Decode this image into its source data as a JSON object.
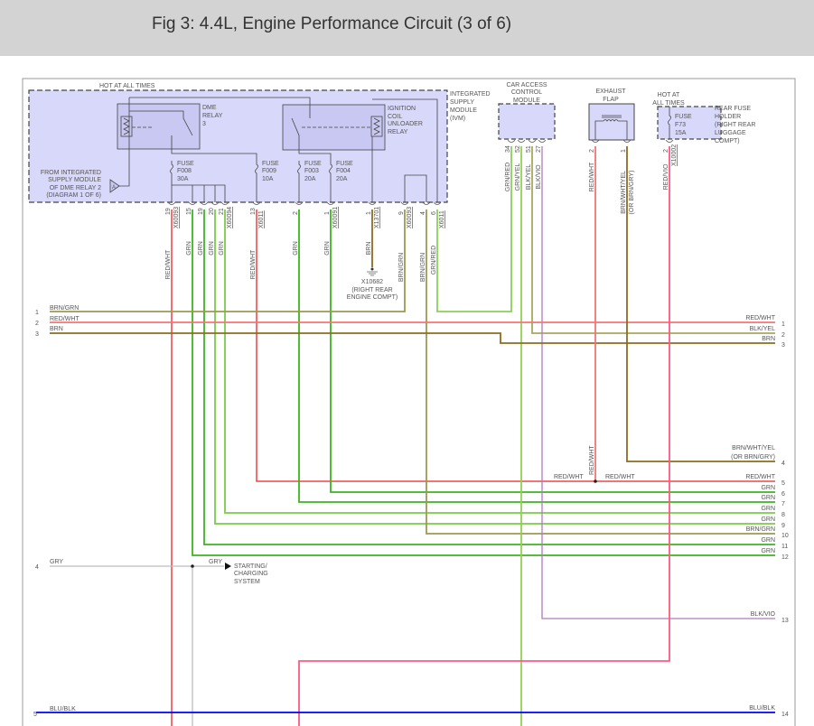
{
  "header": {
    "title": "Fig 3: 4.4L, Engine Performance Circuit (3 of 6)"
  },
  "colors": {
    "red": "#ee2222",
    "redwht": "#f47474",
    "grn": "#3cb521",
    "grnlt": "#7acb4a",
    "brn": "#8c6d1f",
    "brngrn": "#9c9a52",
    "grnred": "#8ccf5a",
    "grnyel": "#8fd14f",
    "blkyel": "#a8a860",
    "vio": "#b07ac0",
    "gry": "#bdbdbd",
    "blu": "#0000ff",
    "redvio": "#ff5a80",
    "ivm_fill": "#d8d8fa",
    "box_fill": "#ccccf5"
  },
  "ivm": {
    "hot_label": "HOT AT ALL TIMES",
    "name_lines": [
      "INTEGRATED",
      "SUPPLY",
      "MODULE",
      "(IVM)"
    ],
    "dme_relay": [
      "DME",
      "RELAY",
      "3"
    ],
    "ign_relay": [
      "IGNITION",
      "COIL",
      "UNLOADER",
      "RELAY"
    ],
    "from_label": [
      "FROM INTEGRATED",
      "SUPPLY MODULE",
      "OF DME RELAY 2",
      "(DIAGRAM 1 OF 6)"
    ],
    "ref_symbol": "A",
    "fuses": [
      {
        "lines": [
          "FUSE",
          "F008",
          "30A"
        ]
      },
      {
        "lines": [
          "FUSE",
          "F009",
          "10A"
        ]
      },
      {
        "lines": [
          "FUSE",
          "F003",
          "20A"
        ]
      },
      {
        "lines": [
          "FUSE",
          "F004",
          "20A"
        ]
      }
    ],
    "pins": [
      {
        "pin": "19",
        "conn": "X60093",
        "wire": "RED/WHT"
      },
      {
        "pin": "15",
        "conn": "",
        "wire": "GRN"
      },
      {
        "pin": "19",
        "conn": "",
        "wire": "GRN"
      },
      {
        "pin": "20",
        "conn": "",
        "wire": "GRN"
      },
      {
        "pin": "21",
        "conn": "X60094",
        "wire": "GRN"
      },
      {
        "pin": "13",
        "conn": "X6011",
        "wire": "RED/WHT"
      },
      {
        "pin": "2",
        "conn": "",
        "wire": "GRN"
      },
      {
        "pin": "1",
        "conn": "X60091",
        "wire": "GRN"
      },
      {
        "pin": "1",
        "conn": "X13701",
        "wire": "BRN"
      },
      {
        "pin": "9",
        "conn": "X60093",
        "wire": "BRN/GRN"
      },
      {
        "pin": "4",
        "conn": "",
        "wire": "BRN/GRN"
      },
      {
        "pin": "6",
        "conn": "X6011",
        "wire": "GRN/RED"
      }
    ]
  },
  "ground": {
    "id": "X10682",
    "lines": [
      "(RIGHT REAR",
      "ENGINE COMPT)"
    ]
  },
  "cas": {
    "name_lines": [
      "CAR ACCESS",
      "CONTROL",
      "MODULE"
    ],
    "pins": [
      {
        "pin": "34",
        "wire": "GRN/RED"
      },
      {
        "pin": "52",
        "wire": "GRN/YEL"
      },
      {
        "pin": "51",
        "wire": "BLK/YEL"
      },
      {
        "pin": "27",
        "wire": "BLK/VIO"
      }
    ]
  },
  "exhaust": {
    "name_lines": [
      "EXHAUST",
      "FLAP"
    ],
    "pins": [
      {
        "pin": "2",
        "wire": "RED/WHT"
      },
      {
        "pin": "1",
        "wire": "BRN/WHT/YEL",
        "wire2": "(OR BRN/GRY)"
      }
    ]
  },
  "rear_fuse": {
    "hot_lines": [
      "HOT AT",
      "ALL TIMES"
    ],
    "fuse_lines": [
      "FUSE",
      "F73",
      "15A"
    ],
    "name_lines": [
      "REAR FUSE",
      "HOLDER",
      "(RIGHT REAR",
      "LUGGAGE",
      "COMPT)"
    ],
    "pin": "2",
    "conn": "X10002",
    "wire": "RED/VIO"
  },
  "left_lines": [
    {
      "num": "1",
      "wire": "BRN/GRN"
    },
    {
      "num": "2",
      "wire": "RED/WHT"
    },
    {
      "num": "3",
      "wire": "BRN"
    },
    {
      "num": "4",
      "wire": "GRY"
    },
    {
      "num": "5",
      "wire": "BLU/BLK"
    }
  ],
  "right_lines": [
    {
      "num": "1",
      "wire": "RED/WHT"
    },
    {
      "num": "2",
      "wire": "BLK/YEL"
    },
    {
      "num": "3",
      "wire": "BRN"
    },
    {
      "num": "4",
      "wire": "BRN/WHT/YEL",
      "wire2": "(OR BRN/GRY)"
    },
    {
      "num": "5",
      "wire": "RED/WHT"
    },
    {
      "num": "6",
      "wire": "GRN"
    },
    {
      "num": "7",
      "wire": "GRN"
    },
    {
      "num": "8",
      "wire": "GRN"
    },
    {
      "num": "9",
      "wire": "GRN"
    },
    {
      "num": "10",
      "wire": "BRN/GRN"
    },
    {
      "num": "11",
      "wire": "GRN"
    },
    {
      "num": "12",
      "wire": "GRN"
    },
    {
      "num": "13",
      "wire": "BLK/VIO"
    },
    {
      "num": "14",
      "wire": "BLU/BLK"
    }
  ],
  "splice_labels": {
    "red_wht_left": "RED/WHT",
    "red_wht_right": "RED/WHT",
    "red_wht_vert": "RED/WHT"
  },
  "starting": {
    "wire": "GRY",
    "lines": [
      "STARTING/",
      "CHARGING",
      "SYSTEM"
    ]
  }
}
